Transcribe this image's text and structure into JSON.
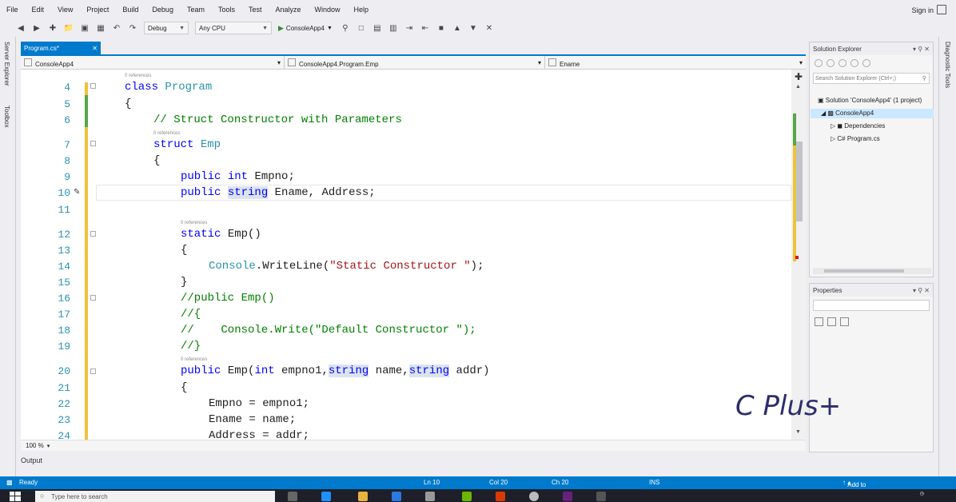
{
  "menu": [
    "File",
    "Edit",
    "View",
    "Project",
    "Build",
    "Debug",
    "Team",
    "Tools",
    "Test",
    "Analyze",
    "Window",
    "Help"
  ],
  "sign_in": "Sign in",
  "toolbar": {
    "config": "Debug",
    "platform": "Any CPU",
    "start_target": "ConsoleApp4"
  },
  "left_rail": [
    "Server Explorer",
    "Toolbox"
  ],
  "right_rail": "Diagnostic Tools",
  "document_tab": "Program.cs*",
  "navbar": {
    "project": "ConsoleApp4",
    "type": "ConsoleApp4.Program.Emp",
    "member": "Ename"
  },
  "code": {
    "lines": [
      {
        "n": "4",
        "refs": "0 references"
      },
      {
        "n": "5"
      },
      {
        "n": "6"
      },
      {
        "n": "7",
        "refs": "0 references"
      },
      {
        "n": "8"
      },
      {
        "n": "9"
      },
      {
        "n": "10"
      },
      {
        "n": "11"
      },
      {
        "n": "12",
        "refs": "0 references"
      },
      {
        "n": "13"
      },
      {
        "n": "14"
      },
      {
        "n": "15"
      },
      {
        "n": "16"
      },
      {
        "n": "17"
      },
      {
        "n": "18"
      },
      {
        "n": "19"
      },
      {
        "n": "20",
        "refs": "0 references"
      },
      {
        "n": "21"
      },
      {
        "n": "22"
      },
      {
        "n": "23"
      },
      {
        "n": "24"
      }
    ],
    "t_class": "class",
    "t_program": "Program",
    "t_open": "{",
    "t_close": "}",
    "t_comment6": "// Struct Constructor with Parameters",
    "t_struct": "struct",
    "t_emp": "Emp",
    "t_public": "public",
    "t_int": "int",
    "t_empno_decl": " Empno;",
    "t_string": "string",
    "t_ename_decl": " Ename, Address;",
    "t_static": "static",
    "t_emp_call": " Emp()",
    "t_console": "Console",
    "t_writeline": ".WriteLine(",
    "t_static_str": "\"Static Constructor \"",
    "t_end_call": ");",
    "t_c16": "//public Emp()",
    "t_c17": "//{",
    "t_c18": "//    Console.Write(\"Default Constructor \");",
    "t_c19": "//}",
    "t_emp_params_a": " Emp(",
    "t_empno1": " empno1,",
    "t_name": " name,",
    "t_addr": " addr)",
    "t_l22": "Empno = empno1;",
    "t_l23": "Ename = name;",
    "t_l24": "Address = addr;"
  },
  "zoom": "100 %",
  "output_tab": "Output",
  "solution_explorer": {
    "title": "Solution Explorer",
    "search_placeholder": "Search Solution Explorer (Ctrl+;)",
    "items": [
      "Solution 'ConsoleApp4' (1 project)",
      "ConsoleApp4",
      "Dependencies",
      "Program.cs"
    ]
  },
  "properties": {
    "title": "Properties"
  },
  "watermark": "C Plus+",
  "status": {
    "ready": "Ready",
    "ln": "Ln 10",
    "col": "Col 20",
    "ch": "Ch 20",
    "mode": "INS",
    "source_control": "Add to Source Control"
  },
  "taskbar": {
    "search": "Type here to search"
  },
  "colors": {
    "accent": "#007acc",
    "keyword": "#0000ff",
    "type": "#2b91af",
    "comment": "#008000",
    "string": "#a31515",
    "changed_saved": "#57a64a",
    "changed_unsaved": "#efc23c"
  }
}
